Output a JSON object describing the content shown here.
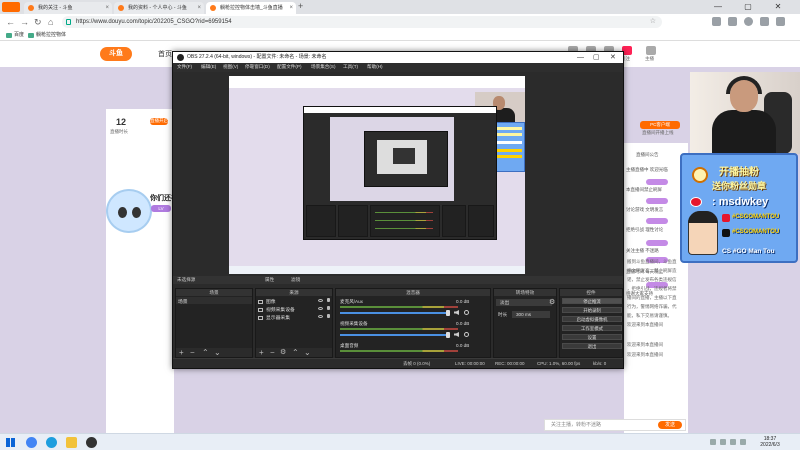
{
  "browser": {
    "tabs": [
      {
        "title": "我的关注 - 斗鱼"
      },
      {
        "title": "我的资料 - 个人中心 - 斗鱼"
      },
      {
        "title": "躺枪拉控物体击墙_斗鱼直播"
      }
    ],
    "url": "https://www.douyu.com/topic/202205_CSGO?rid=6959154",
    "bookmarks": [
      "百度",
      "躺枪拉控物体"
    ]
  },
  "site": {
    "logo": "斗鱼",
    "nav_home": "首页",
    "header_icon_labels": [
      "下载",
      "历史",
      "消息",
      "关注",
      "主播"
    ],
    "stat_value": "12",
    "stat_label": "直播时长",
    "stat_pill": "直播开启",
    "side_title": "你们还在",
    "side_pill": "LV",
    "pc_button": "PC客户端",
    "pc_caption": "直播间开播上线",
    "chat_header": "直播间公告",
    "chat_lines": [
      "主播直播中 欢迎光临",
      "本直播间禁止刷屏",
      "讨论游戏 文明发言",
      "拒绝引战 理性讨论",
      "关注主播 不迷路",
      "直播时间 每天晚上",
      "感谢大家支持"
    ],
    "chat_tail": [
      "搬到斗鱼直播间，斗鱼直",
      "请文明发言，禁止刷屏造",
      "谣，禁止发布各类违规信",
      "，拒绝引战，违规者将禁",
      "播间的直播，主播以下直",
      "行为，警惕网络诈骗，代",
      "能，私下交易请谨慎。",
      "欢迎来到本直播间"
    ],
    "chat_tail2": [
      "欢迎来到本直播间",
      "欢迎来到本直播间"
    ],
    "chat_input_placeholder": "关注主播，转粉不迷路",
    "send_label": "发送"
  },
  "promo": {
    "line1": "开播抽粉",
    "line2": "送你粉丝勋章",
    "handle": ": msdwkey",
    "weibo": "#CSGOMANTOU",
    "douyin": "#CSGOMANTOU",
    "footer": "CS #GO Man Tou"
  },
  "obs": {
    "title": "OBS 27.2.4 (64-bit, windows) - 配置文件: 未命名 - 场景: 未命名",
    "menu": [
      "文件(F)",
      "编辑(E)",
      "视图(V)",
      "停靠窗口(D)",
      "配置文件(P)",
      "场景集合(S)",
      "工具(T)",
      "帮助(H)"
    ],
    "divider_left": "未选择源",
    "divider_mid1": "属性",
    "divider_mid2": "滤镜",
    "docks": {
      "scenes": {
        "title": "场景",
        "items": [
          "场景"
        ]
      },
      "sources": {
        "title": "来源",
        "items": [
          "图像",
          "视频采集设备",
          "显示器采集"
        ]
      },
      "mixer": {
        "title": "混音器",
        "channels": [
          {
            "name": "麦克风/Aux",
            "value": "0.0 dB"
          },
          {
            "name": "视频采集设备",
            "value": "0.0 dB"
          },
          {
            "name": "桌面音频",
            "value": "0.0 dB"
          }
        ]
      },
      "transitions": {
        "title": "转场特效",
        "type": "淡出",
        "duration_label": "时长",
        "duration": "300 ms"
      },
      "controls": {
        "title": "控件",
        "buttons": [
          "停止推流",
          "开始录制",
          "启动虚拟摄像机",
          "工作室模式",
          "设置",
          "退出"
        ]
      }
    },
    "status": {
      "dropped": "丢帧 0 (0.0%)",
      "live": "LIVE: 00:00:00",
      "rec": "REC: 00:00:00",
      "cpu": "CPU: 1.0%, 60.00 fps",
      "kbps": "kb/s: 0"
    }
  },
  "taskbar": {
    "time": "18:37",
    "date": "2022/6/3"
  }
}
